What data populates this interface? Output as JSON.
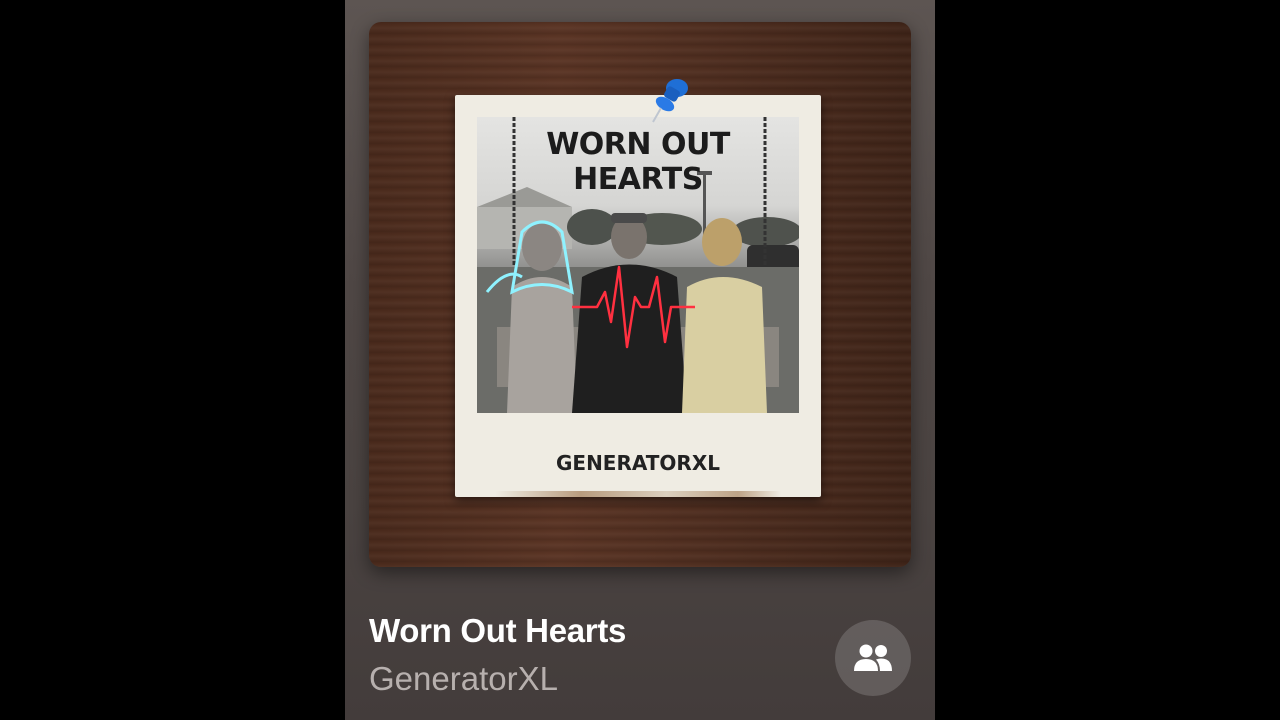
{
  "artwork": {
    "photo_title": "WORN OUT HEARTS",
    "caption": "GENERATORXL"
  },
  "track": {
    "title": "Worn Out Hearts",
    "artist": "GeneratorXL"
  },
  "controls": {
    "share_icon": "people-icon"
  },
  "colors": {
    "background": "#000000",
    "card": "#4f4745",
    "title_text": "#ffffff",
    "artist_text": "#b7b0ae",
    "heartbeat": "#ff3040",
    "pin": "#1f6fd6"
  }
}
